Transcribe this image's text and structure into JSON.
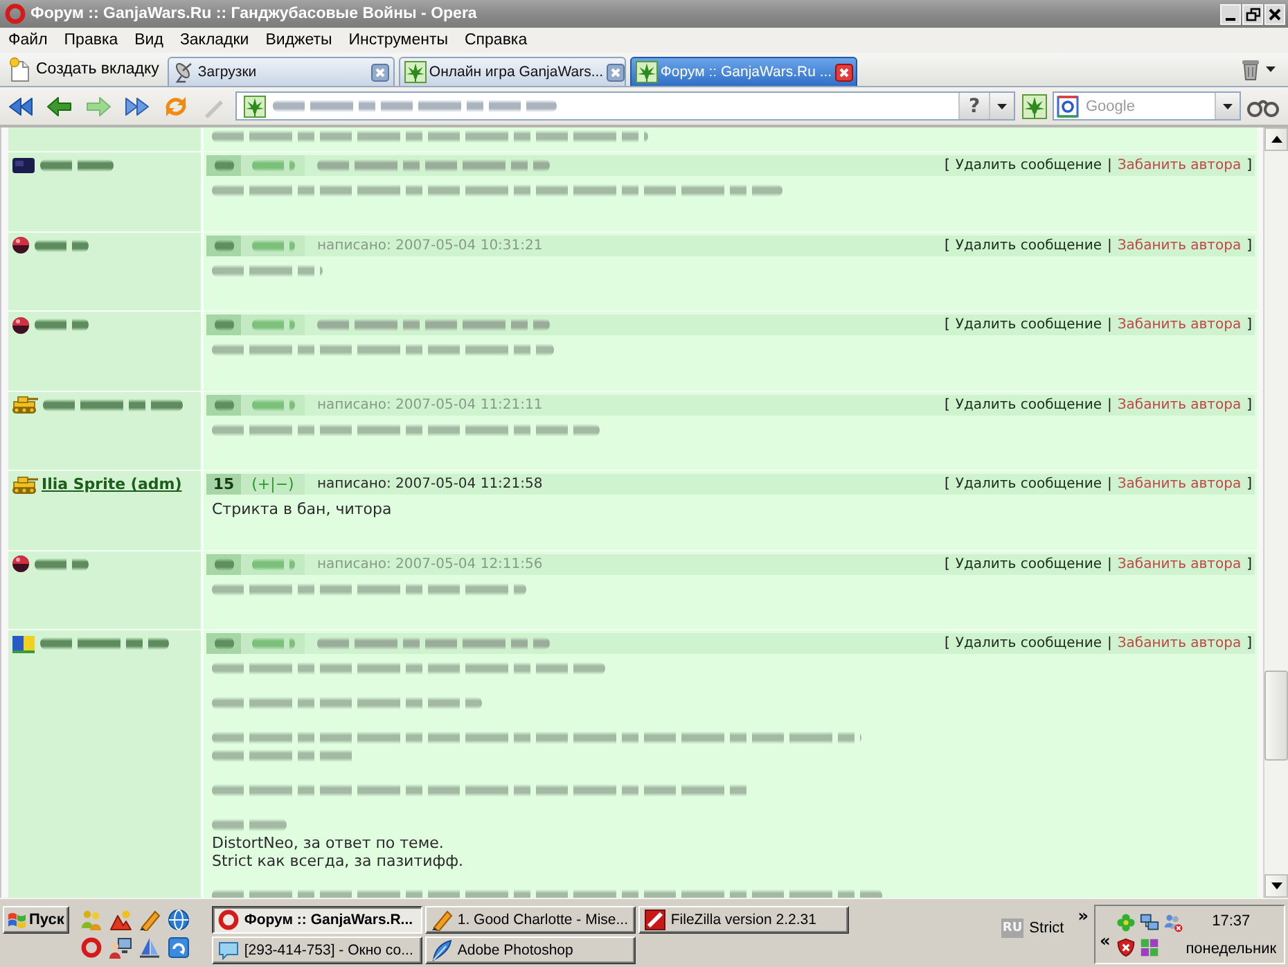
{
  "window": {
    "title": "Форум :: GanjaWars.Ru :: Ганджубасовые Войны - Opera",
    "buttons": [
      {
        "kind": "minimize"
      },
      {
        "kind": "restore"
      },
      {
        "kind": "close"
      }
    ]
  },
  "menu": [
    "Файл",
    "Правка",
    "Вид",
    "Закладки",
    "Виджеты",
    "Инструменты",
    "Справка"
  ],
  "tab_bar": {
    "new_tab": "Создать вкладку",
    "tabs": [
      {
        "label": "Загрузки",
        "kind": "downloads",
        "selected": false
      },
      {
        "label": "Онлайн игра GanjaWars...",
        "kind": "site",
        "selected": false
      },
      {
        "label": "Форум :: GanjaWars.Ru ...",
        "kind": "site",
        "selected": true
      }
    ]
  },
  "toolbar": {
    "nav": [
      {
        "kind": "rewind",
        "disabled": false
      },
      {
        "kind": "back",
        "disabled": false
      },
      {
        "kind": "forward",
        "disabled": true
      },
      {
        "kind": "fast_forward",
        "disabled": false
      },
      {
        "kind": "reload",
        "disabled": false
      },
      {
        "kind": "edit",
        "disabled": true
      }
    ],
    "address": {
      "url_blurred": true,
      "info_button": "?"
    },
    "search": {
      "placeholder": "Google"
    }
  },
  "forum": {
    "posts": [
      {
        "kind": "continued",
        "body": [
          [
            {
              "kind": "blurred"
            }
          ]
        ]
      },
      {
        "kind": "post",
        "blurred": true,
        "avatar": {
          "kind": "block"
        },
        "admin_links": {
          "open": "[",
          "delete": "Удалить сообщение",
          "separator": "|",
          "ban": "Забанить автора",
          "close": "]"
        },
        "body": [
          [
            {
              "kind": "blurred"
            }
          ]
        ]
      },
      {
        "kind": "post",
        "blurred": true,
        "avatar": {
          "kind": "ball"
        },
        "date": "написано: 2007-05-04 10:31:21",
        "admin_links": {
          "open": "[",
          "delete": "Удалить сообщение",
          "separator": "|",
          "ban": "Забанить автора",
          "close": "]"
        },
        "body": [
          [
            {
              "kind": "blurred"
            }
          ]
        ]
      },
      {
        "kind": "post",
        "blurred": true,
        "avatar": {
          "kind": "ball"
        },
        "admin_links": {
          "open": "[",
          "delete": "Удалить сообщение",
          "separator": "|",
          "ban": "Забанить автора",
          "close": "]"
        },
        "body": [
          [
            {
              "kind": "blurred"
            }
          ]
        ]
      },
      {
        "kind": "post",
        "blurred": true,
        "avatar": {
          "kind": "tank"
        },
        "date": "написано: 2007-05-04 11:21:11",
        "admin_links": {
          "open": "[",
          "delete": "Удалить сообщение",
          "separator": "|",
          "ban": "Забанить автора",
          "close": "]"
        },
        "body": [
          [
            {
              "kind": "blurred"
            }
          ]
        ]
      },
      {
        "kind": "post",
        "blurred": false,
        "avatar": {
          "kind": "tank"
        },
        "author": "Ilia Sprite (adm)",
        "number": "15",
        "rating": "(+|−)",
        "date": "написано: 2007-05-04 11:21:58",
        "admin_links": {
          "open": "[",
          "delete": "Удалить сообщение",
          "separator": "|",
          "ban": "Забанить автора",
          "close": "]"
        },
        "body": [
          [
            {
              "kind": "text",
              "text": "Стрикта в бан, читора"
            }
          ]
        ]
      },
      {
        "kind": "post",
        "blurred": true,
        "avatar": {
          "kind": "ball"
        },
        "date": "написано: 2007-05-04 12:11:56",
        "admin_links": {
          "open": "[",
          "delete": "Удалить сообщение",
          "separator": "|",
          "ban": "Забанить автора",
          "close": "]"
        },
        "body": [
          [
            {
              "kind": "blurred"
            }
          ]
        ]
      },
      {
        "kind": "post",
        "blurred": true,
        "avatar": {
          "kind": "flag"
        },
        "admin_links": {
          "open": "[",
          "delete": "Удалить сообщение",
          "separator": "|",
          "ban": "Забанить автора",
          "close": "]"
        },
        "body": [
          [
            {
              "kind": "blurred"
            }
          ],
          [
            {
              "kind": "blurred"
            }
          ],
          [
            {
              "kind": "blurred"
            },
            {
              "kind": "blurred"
            }
          ],
          [
            {
              "kind": "blurred"
            }
          ],
          [
            {
              "kind": "blurred"
            },
            {
              "kind": "text",
              "text": "DistortNeo, за ответ по теме."
            },
            {
              "kind": "text",
              "text": "Strict как всегда, за пазитифф."
            }
          ],
          [
            {
              "kind": "blurred"
            }
          ]
        ]
      }
    ]
  },
  "taskbar": {
    "start": "Пуск",
    "quick_launch": [
      {
        "kind": "people"
      },
      {
        "kind": "mountains"
      },
      {
        "kind": "pencil"
      },
      {
        "kind": "globe"
      },
      {
        "kind": "ring"
      },
      {
        "kind": "computer_user"
      },
      {
        "kind": "sail"
      },
      {
        "kind": "curved_arrow"
      }
    ],
    "tasks": [
      {
        "label": "Форум :: GanjaWars.R...",
        "kind": "ring",
        "selected": true
      },
      {
        "label": "1. Good Charlotte - Mise...",
        "kind": "pencil",
        "selected": false
      },
      {
        "label": "FileZilla version 2.2.31",
        "kind": "square_logo",
        "selected": false
      },
      {
        "label": "[293-414-753] - Окно со...",
        "kind": "chat",
        "selected": false
      },
      {
        "label": "Adobe Photoshop",
        "kind": "feather",
        "selected": false
      }
    ],
    "language": "RU",
    "toolbar_label": "Strict",
    "toolbar_chevron": "»",
    "tray": {
      "chevron": "«",
      "icons": [
        {
          "kind": "clover"
        },
        {
          "kind": "network"
        },
        {
          "kind": "people_cross"
        },
        {
          "kind": "shield"
        },
        {
          "kind": "grid"
        }
      ],
      "time": "17:37",
      "day": "понедельник"
    }
  }
}
